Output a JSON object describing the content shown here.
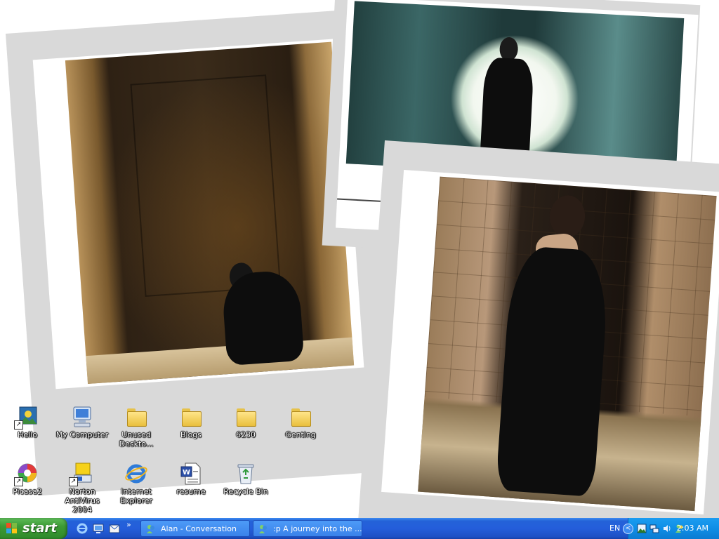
{
  "desktop": {
    "icons": [
      {
        "label": "Hello",
        "kind": "image-shortcut-icon"
      },
      {
        "label": "My Computer",
        "kind": "computer-icon"
      },
      {
        "label": "Unused Deskto...",
        "kind": "folder-icon"
      },
      {
        "label": "Blogs",
        "kind": "folder-icon"
      },
      {
        "label": "6230",
        "kind": "folder-icon"
      },
      {
        "label": "Genting",
        "kind": "folder-icon"
      },
      {
        "label": "Picasa2",
        "kind": "picasa-icon"
      },
      {
        "label": "Norton AntiVirus 2004",
        "kind": "norton-icon"
      },
      {
        "label": "Internet Explorer",
        "kind": "internet-explorer-icon"
      },
      {
        "label": "resume",
        "kind": "word-document-icon"
      },
      {
        "label": "Recycle Bin",
        "kind": "recycle-bin-icon"
      }
    ],
    "wallpaper": "photo-collage"
  },
  "taskbar": {
    "start_label": "start",
    "quick_launch_more": "»",
    "tasks": [
      {
        "label": "Alan - Conversation"
      },
      {
        "label": ":p A journey into the ..."
      }
    ],
    "language": "EN",
    "clock": "2:03 AM"
  },
  "colors": {
    "taskbar_blue": "#245edb",
    "start_green": "#3c9a35",
    "tray_blue": "#0f8ee6"
  }
}
